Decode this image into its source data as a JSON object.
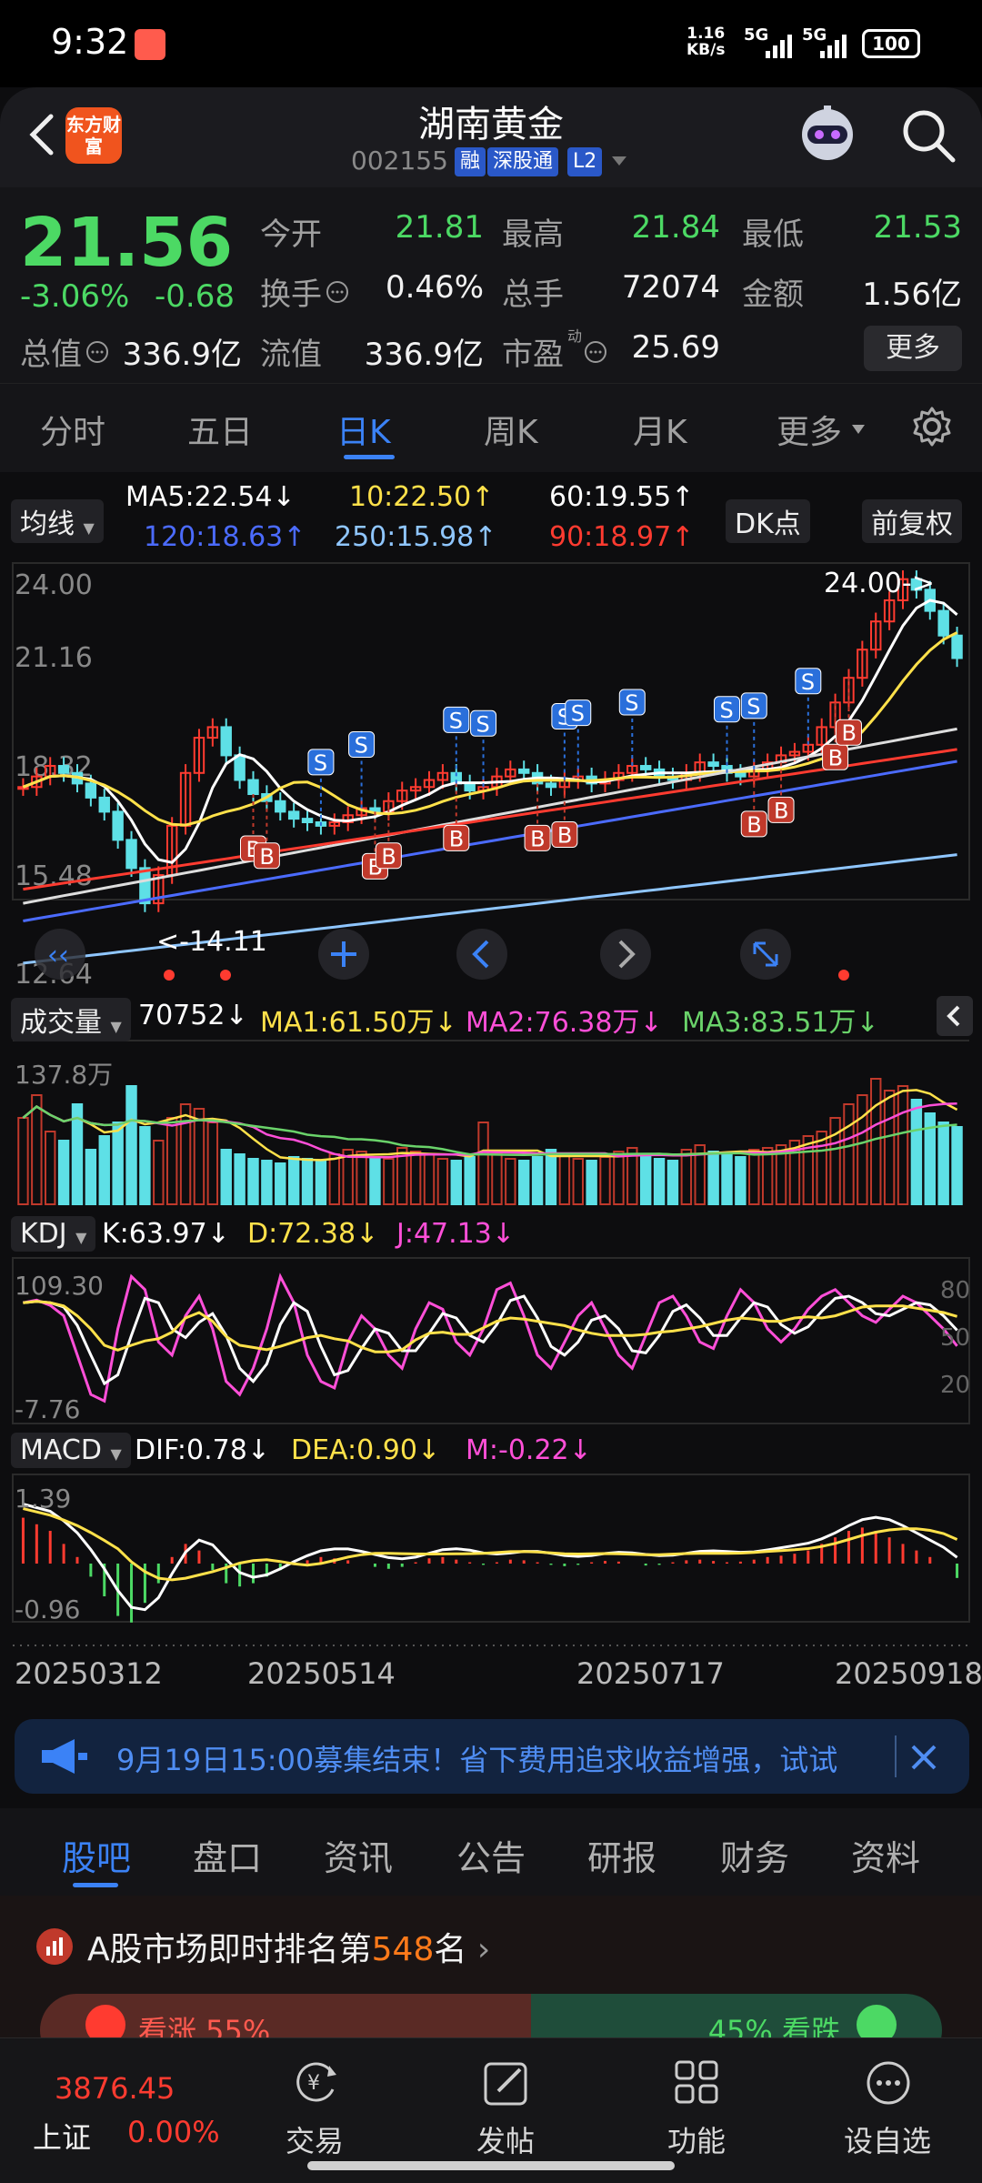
{
  "status_bar": {
    "time": "9:32",
    "net_speed_value": "1.16",
    "net_speed_unit": "KB/s",
    "sim1": "5G",
    "sim2": "5G",
    "battery": "100"
  },
  "header": {
    "logo_text": "东方财富",
    "name": "湖南黄金",
    "code": "002155",
    "tags": [
      "融",
      "深股通",
      "L2"
    ]
  },
  "quote": {
    "price": "21.56",
    "change_pct": "-3.06%",
    "change_abs": "-0.68",
    "fields": {
      "open_label": "今开",
      "open": "21.81",
      "high_label": "最高",
      "high": "21.84",
      "low_label": "最低",
      "low": "21.53",
      "turnover_label": "换手",
      "turnover": "0.46%",
      "volume_label": "总手",
      "volume": "72074",
      "amount_label": "金额",
      "amount": "1.56亿",
      "mktcap_label": "总值",
      "mktcap": "336.9亿",
      "float_label": "流值",
      "float": "336.9亿",
      "pe_label": "市盈",
      "pe_superscript": "动",
      "pe": "25.69"
    },
    "more_label": "更多"
  },
  "period_tabs": [
    "分时",
    "五日",
    "日K",
    "周K",
    "月K",
    "更多"
  ],
  "active_period": "日K",
  "ma": {
    "selector": "均线",
    "ma5": "MA5:22.54",
    "ma10": "10:22.50",
    "ma60": "60:19.55",
    "ma120": "120:18.63",
    "ma250": "250:15.98",
    "ma90": "90:18.97",
    "dk_label": "DK点",
    "adjust_label": "前复权",
    "colors": {
      "ma5": "#ffffff",
      "ma10": "#ffe14a",
      "ma60": "#ffffff",
      "ma120": "#4b6bff",
      "ma250": "#8fc6ff",
      "ma90": "#ff3b30"
    }
  },
  "chart_data": [
    {
      "type": "candlestick",
      "y_ticks": [
        "24.00",
        "21.16",
        "18.32",
        "15.48",
        "12.64"
      ],
      "ylim": [
        12.64,
        24.0
      ],
      "annotations": {
        "high_label": "24.00->",
        "low_label": "<-14.11"
      },
      "signals_B": 11,
      "signals_S": 10,
      "close_series": [
        17.9,
        18.2,
        18.5,
        18.3,
        18.0,
        17.6,
        17.2,
        16.4,
        15.6,
        14.6,
        15.4,
        16.8,
        18.3,
        19.3,
        19.6,
        18.8,
        18.1,
        17.7,
        17.5,
        17.2,
        17.0,
        16.9,
        16.8,
        16.9,
        17.1,
        17.3,
        17.2,
        17.5,
        17.8,
        17.9,
        18.1,
        18.3,
        18.0,
        17.8,
        17.9,
        18.2,
        18.4,
        18.3,
        18.0,
        17.9,
        18.1,
        18.2,
        18.0,
        18.1,
        18.3,
        18.5,
        18.4,
        18.2,
        18.1,
        18.3,
        18.6,
        18.5,
        18.3,
        18.2,
        18.4,
        18.6,
        18.8,
        18.9,
        19.1,
        19.6,
        20.3,
        21.0,
        21.8,
        22.6,
        23.2,
        23.8,
        23.5,
        22.9,
        22.2,
        21.56
      ]
    },
    {
      "type": "bar",
      "title": "成交量",
      "latest": "70752",
      "ma1": "MA1:61.50万",
      "ma2": "MA2:76.38万",
      "ma3": "MA3:83.51万",
      "y_tick": "137.8万",
      "ma_colors": {
        "ma1": "#ffe14a",
        "ma2": "#ff4fd8",
        "ma3": "#6ad36a"
      },
      "values": [
        95,
        120,
        80,
        70,
        110,
        60,
        75,
        90,
        130,
        85,
        70,
        95,
        110,
        105,
        90,
        60,
        55,
        50,
        48,
        45,
        52,
        50,
        48,
        55,
        60,
        58,
        52,
        50,
        62,
        58,
        55,
        50,
        48,
        52,
        90,
        55,
        50,
        48,
        52,
        60,
        55,
        50,
        48,
        52,
        58,
        62,
        55,
        50,
        48,
        60,
        65,
        58,
        55,
        52,
        60,
        62,
        65,
        70,
        75,
        80,
        95,
        110,
        120,
        138,
        125,
        130,
        115,
        100,
        90,
        85
      ]
    },
    {
      "type": "line",
      "title": "KDJ",
      "k": "K:63.97",
      "d": "D:72.38",
      "j": "J:47.13",
      "y_ticks_left": [
        "109.30",
        "-7.76"
      ],
      "y_ticks_right": [
        "80",
        "50",
        "20"
      ],
      "j_values": [
        80,
        82,
        78,
        70,
        40,
        10,
        5,
        60,
        100,
        90,
        50,
        40,
        70,
        85,
        60,
        20,
        10,
        30,
        60,
        100,
        80,
        40,
        20,
        15,
        50,
        70,
        60,
        40,
        30,
        60,
        80,
        75,
        50,
        40,
        60,
        90,
        95,
        70,
        40,
        30,
        50,
        70,
        80,
        60,
        40,
        30,
        55,
        80,
        85,
        70,
        50,
        45,
        70,
        90,
        80,
        60,
        50,
        60,
        75,
        85,
        90,
        80,
        70,
        65,
        75,
        85,
        80,
        70,
        60,
        47
      ]
    },
    {
      "type": "bar",
      "title": "MACD",
      "dif": "DIF:0.78",
      "dea": "DEA:0.90",
      "m": "M:-0.22",
      "y_ticks": [
        "1.39",
        "-0.96"
      ],
      "x_ticks": [
        "20250312",
        "20250514",
        "20250717",
        "20250918"
      ],
      "hist": [
        0.7,
        0.6,
        0.5,
        0.3,
        0.1,
        -0.2,
        -0.5,
        -0.8,
        -0.9,
        -0.6,
        -0.3,
        0.1,
        0.3,
        0.2,
        -0.1,
        -0.3,
        -0.35,
        -0.3,
        -0.2,
        -0.1,
        0.0,
        0.05,
        0.1,
        0.08,
        0.05,
        0.0,
        -0.05,
        -0.08,
        -0.05,
        0.02,
        0.08,
        0.1,
        0.06,
        0.02,
        -0.02,
        0.02,
        0.06,
        0.05,
        0.02,
        -0.02,
        -0.04,
        -0.02,
        0.02,
        0.04,
        0.03,
        0.0,
        -0.03,
        -0.02,
        0.02,
        0.05,
        0.06,
        0.04,
        0.02,
        0.03,
        0.06,
        0.1,
        0.12,
        0.15,
        0.2,
        0.3,
        0.4,
        0.5,
        0.55,
        0.5,
        0.4,
        0.3,
        0.2,
        0.1,
        0.0,
        -0.22
      ]
    }
  ],
  "banner": {
    "text": "9月19日15:00募集结束！省下费用追求收益增强，试试"
  },
  "info_tabs": [
    "股吧",
    "盘口",
    "资讯",
    "公告",
    "研报",
    "财务",
    "资料"
  ],
  "rank": {
    "prefix": "A股市场即时排名第",
    "num": "548",
    "suffix": "名",
    "up_text": "看涨 55%",
    "down_text": "45% 看跌"
  },
  "bottom_nav": {
    "index_value": "3876.45",
    "index_name": "上证",
    "index_pct": "0.00%",
    "items": [
      "交易",
      "发帖",
      "功能",
      "设自选"
    ]
  }
}
